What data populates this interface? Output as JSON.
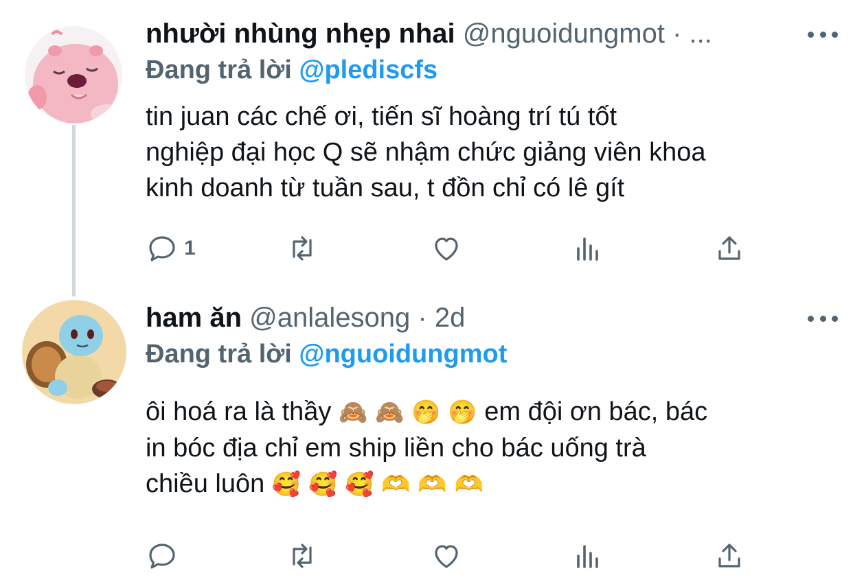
{
  "tweet1": {
    "name": "nhười nhùng nhẹp nhai",
    "handle": "@nguoidungmot",
    "separator": "·",
    "time": "...",
    "reply_prefix": "Đang trả lời",
    "reply_to": "@pledisc fs",
    "body_lines": [
      "tin juan các chế ơi, tiến sĩ hoàng trí tú tốt",
      "nghiệp đại học Q sẽ nhậm chức giảng viên khoa",
      "kinh doanh từ tuần sau, t đồn chỉ có lê gít"
    ],
    "reply_count": "1"
  },
  "tweet2": {
    "name": "ham ăn",
    "handle": "@anlalesong",
    "separator": "·",
    "time": "2d",
    "reply_prefix": "Đang trả lời",
    "reply_to": "@nguoidungmot",
    "body_line1_a": "ôi hoá ra là thầy",
    "body_line1_emojis": "🙈 🙈 🤭 🤭",
    "body_line1_b": "em đội ơn bác, bác",
    "body_line2": "in bóc địa chỉ em ship liền cho bác uống trà",
    "body_line3_a": "chiều luôn",
    "body_line3_emojis": "🥰 🥰 🥰 🫶 🫶 🫶",
    "reply_count": ""
  },
  "icons": {
    "reply": "reply-icon",
    "retweet": "retweet-icon",
    "like": "like-icon",
    "analytics": "analytics-icon",
    "share": "share-icon",
    "more": "more-icon"
  },
  "colors": {
    "text": "#0f1419",
    "muted": "#536471",
    "link": "#1d9bf0",
    "thread_line": "#cfd9de"
  }
}
